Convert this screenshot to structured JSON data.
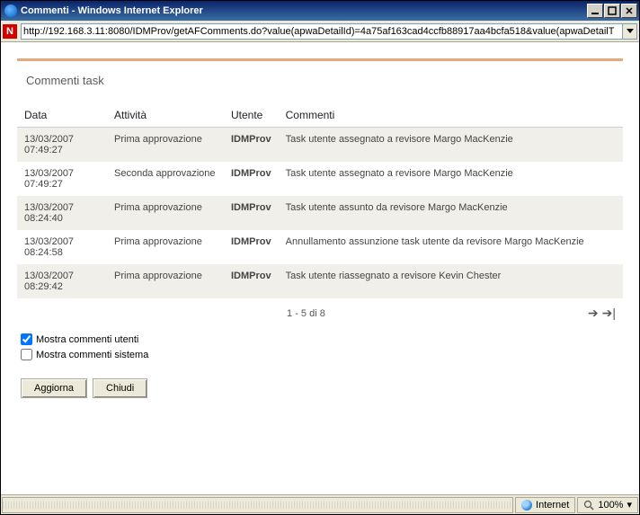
{
  "window": {
    "title": "Commenti - Windows Internet Explorer"
  },
  "address": {
    "url": "http://192.168.3.11:8080/IDMProv/getAFComments.do?value(apwaDetailId)=4a75af163cad4ccfb88917aa4bcfa518&value(apwaDetailT"
  },
  "panel": {
    "title": "Commenti task"
  },
  "columns": {
    "date": "Data",
    "activity": "Attività",
    "user": "Utente",
    "comment": "Commenti"
  },
  "rows": [
    {
      "date": "13/03/2007 07:49:27",
      "activity": "Prima approvazione",
      "user": "IDMProv",
      "comment": "Task utente assegnato a revisore Margo MacKenzie"
    },
    {
      "date": "13/03/2007 07:49:27",
      "activity": "Seconda approvazione",
      "user": "IDMProv",
      "comment": "Task utente assegnato a revisore Margo MacKenzie"
    },
    {
      "date": "13/03/2007 08:24:40",
      "activity": "Prima approvazione",
      "user": "IDMProv",
      "comment": "Task utente assunto da revisore Margo MacKenzie"
    },
    {
      "date": "13/03/2007 08:24:58",
      "activity": "Prima approvazione",
      "user": "IDMProv",
      "comment": "Annullamento assunzione task utente da revisore Margo MacKenzie"
    },
    {
      "date": "13/03/2007 08:29:42",
      "activity": "Prima approvazione",
      "user": "IDMProv",
      "comment": "Task utente riassegnato a revisore Kevin Chester"
    }
  ],
  "pager": {
    "text": "1 - 5 di 8"
  },
  "checks": {
    "user_comments": {
      "label": "Mostra commenti utenti",
      "checked": true
    },
    "system_comments": {
      "label": "Mostra commenti sistema",
      "checked": false
    }
  },
  "buttons": {
    "refresh": "Aggiorna",
    "close": "Chiudi"
  },
  "status": {
    "zone": "Internet",
    "zoom": "100%"
  }
}
